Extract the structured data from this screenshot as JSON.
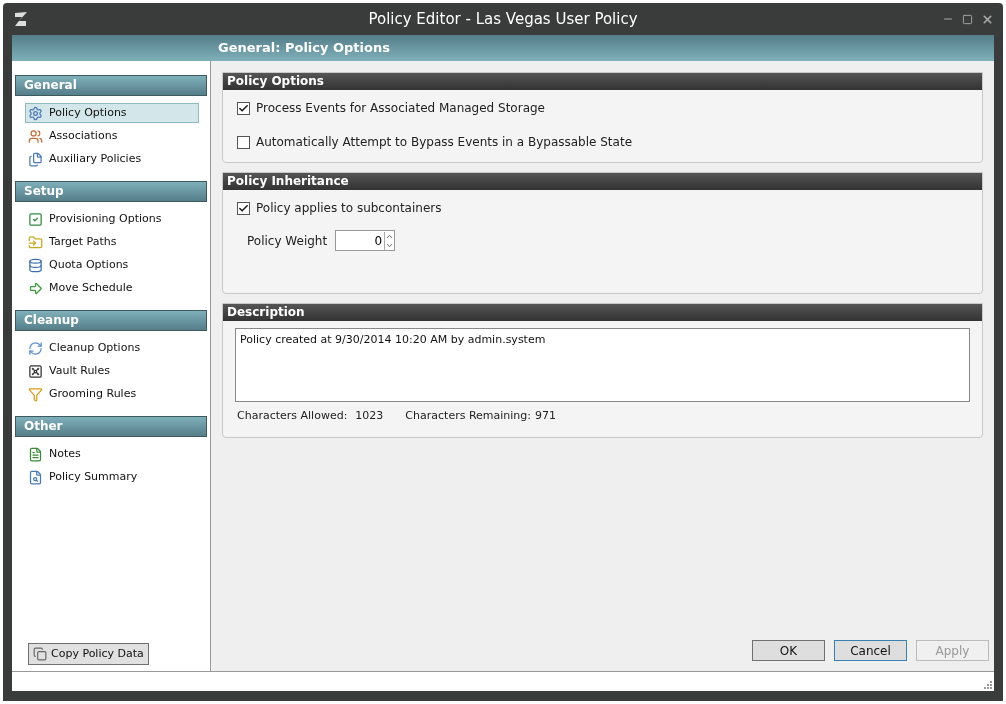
{
  "window": {
    "title": "Policy Editor - Las Vegas User Policy"
  },
  "header": {
    "title": "General: Policy Options"
  },
  "sidebar": {
    "sections": [
      {
        "title": "General",
        "items": [
          {
            "label": "Policy Options",
            "selected": true
          },
          {
            "label": "Associations",
            "selected": false
          },
          {
            "label": "Auxiliary Policies",
            "selected": false
          }
        ]
      },
      {
        "title": "Setup",
        "items": [
          {
            "label": "Provisioning Options",
            "selected": false
          },
          {
            "label": "Target Paths",
            "selected": false
          },
          {
            "label": "Quota Options",
            "selected": false
          },
          {
            "label": "Move Schedule",
            "selected": false
          }
        ]
      },
      {
        "title": "Cleanup",
        "items": [
          {
            "label": "Cleanup Options",
            "selected": false
          },
          {
            "label": "Vault Rules",
            "selected": false
          },
          {
            "label": "Grooming Rules",
            "selected": false
          }
        ]
      },
      {
        "title": "Other",
        "items": [
          {
            "label": "Notes",
            "selected": false
          },
          {
            "label": "Policy Summary",
            "selected": false
          }
        ]
      }
    ],
    "copy_button": "Copy Policy Data"
  },
  "policy_options": {
    "title": "Policy Options",
    "checkboxes": [
      {
        "label": "Process Events for Associated Managed Storage",
        "checked": true
      },
      {
        "label": "Automatically Attempt to Bypass Events in a Bypassable State",
        "checked": false
      }
    ]
  },
  "policy_inheritance": {
    "title": "Policy Inheritance",
    "checkbox": {
      "label": "Policy applies to subcontainers",
      "checked": true
    },
    "weight_label": "Policy Weight",
    "weight_value": "0"
  },
  "description": {
    "title": "Description",
    "value": "Policy created at 9/30/2014 10:20 AM by admin.system",
    "allowed_label": "Characters Allowed:",
    "allowed_value": "1023",
    "remaining_label": "Characters Remaining:",
    "remaining_value": "971"
  },
  "buttons": [
    {
      "label": "OK",
      "disabled": false,
      "focused": false
    },
    {
      "label": "Cancel",
      "disabled": false,
      "focused": true
    },
    {
      "label": "Apply",
      "disabled": true,
      "focused": false
    }
  ]
}
